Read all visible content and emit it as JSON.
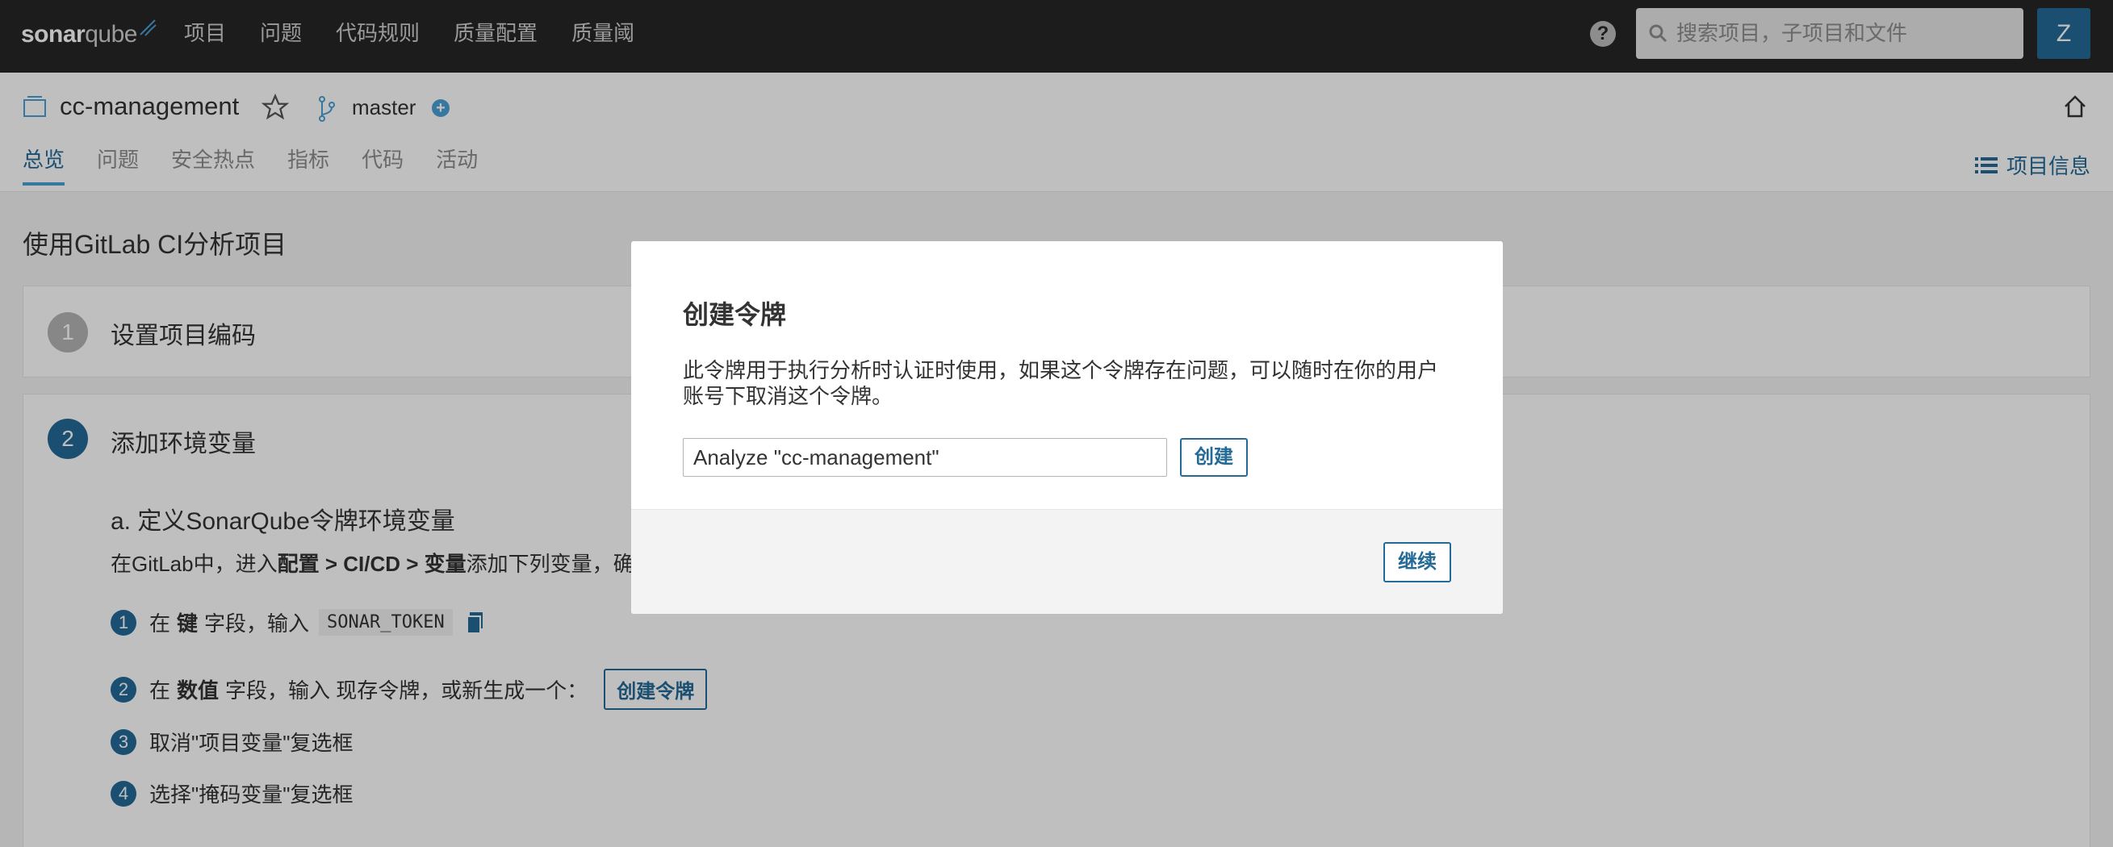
{
  "topnav": {
    "logo_bold": "sonar",
    "logo_light": "qube",
    "menu": [
      "项目",
      "问题",
      "代码规则",
      "质量配置",
      "质量阈"
    ],
    "help_label": "?",
    "search_placeholder": "搜索项目，子项目和文件",
    "avatar_letter": "Z"
  },
  "project": {
    "name": "cc-management",
    "branch": "master",
    "branch_add": "+",
    "tabs": [
      "总览",
      "问题",
      "安全热点",
      "指标",
      "代码",
      "活动"
    ],
    "active_tab": "总览",
    "info_label": "项目信息"
  },
  "main": {
    "page_title": "使用GitLab CI分析项目",
    "step1": {
      "number": "1",
      "title": "设置项目编码"
    },
    "step2": {
      "number": "2",
      "title": "添加环境变量",
      "sub_title": "a. 定义SonarQube令牌环境变量",
      "desc_prefix": "在GitLab中，进入",
      "desc_bold": "配置 > CI/CD > 变量",
      "desc_suffix": "添加下列变量，确",
      "instructions": [
        {
          "num": "1",
          "pre": "在",
          "bold": "键",
          "mid": "字段，输入",
          "code": "SONAR_TOKEN"
        },
        {
          "num": "2",
          "pre": "在",
          "bold": "数值",
          "mid": "字段，输入 现存令牌，或新生成一个：",
          "button": "创建令牌"
        },
        {
          "num": "3",
          "text": "取消\"项目变量\"复选框"
        },
        {
          "num": "4",
          "text": "选择\"掩码变量\"复选框"
        }
      ]
    }
  },
  "modal": {
    "title": "创建令牌",
    "description": "此令牌用于执行分析时认证时使用，如果这个令牌存在问题，可以随时在你的用户账号下取消这个令牌。",
    "input_value": "Analyze \"cc-management\"",
    "create_label": "创建",
    "continue_label": "继续"
  },
  "colors": {
    "nav_bg": "#262626",
    "accent": "#236a97",
    "link_blue": "#4b9fd5"
  }
}
